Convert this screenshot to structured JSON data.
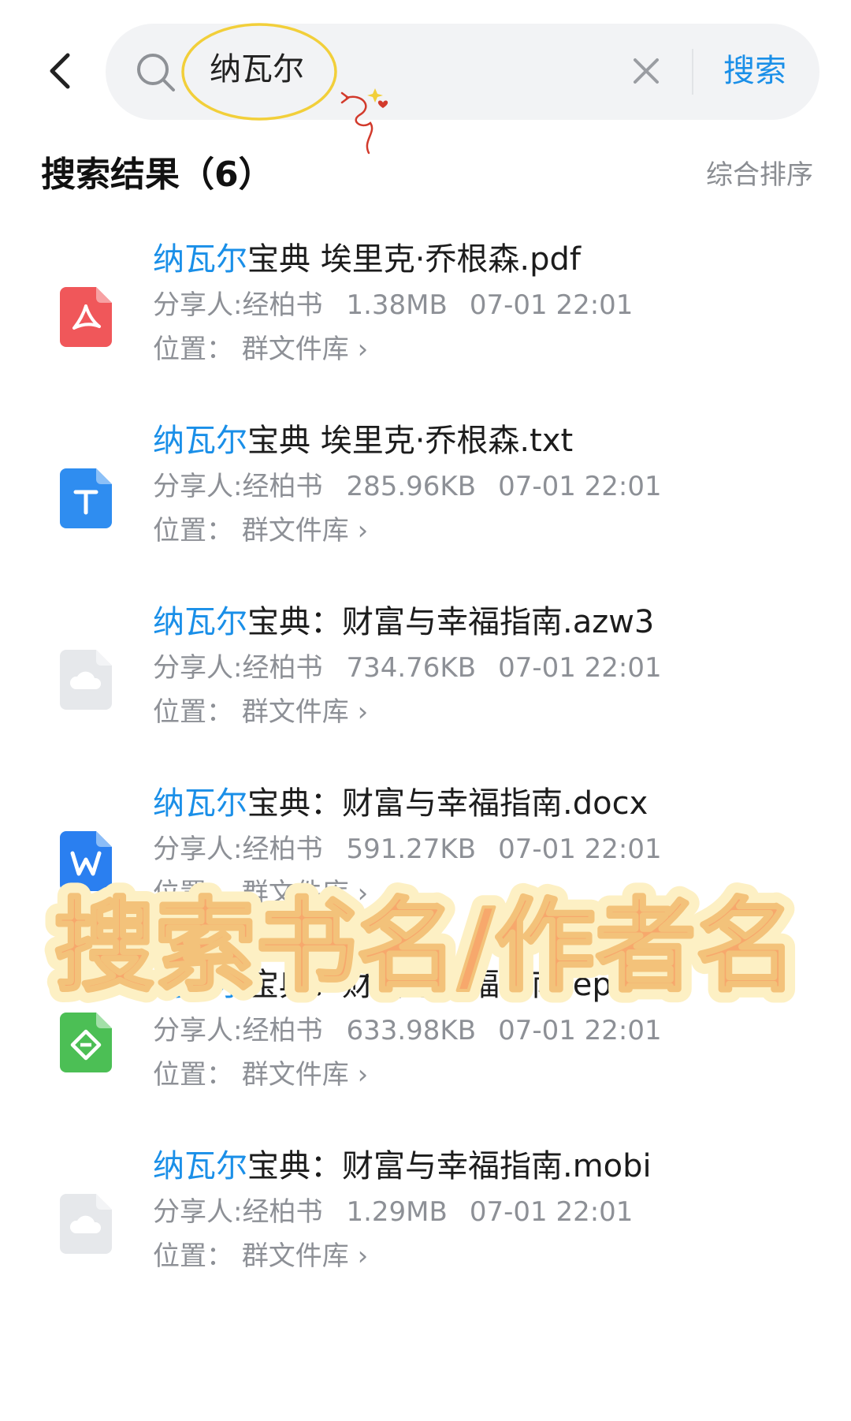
{
  "search": {
    "query": "纳瓦尔",
    "submit_label": "搜索"
  },
  "results_header": {
    "title": "搜索结果（6）",
    "sort_label": "综合排序"
  },
  "results": [
    {
      "name_highlight": "纳瓦尔",
      "name_rest": "宝典 埃里克·乔根森.pdf",
      "sharer": "分享人:经柏书",
      "size": "1.38MB",
      "time": "07-01 22:01",
      "location": "位置：  群文件库",
      "icon": "pdf-file-icon"
    },
    {
      "name_highlight": "纳瓦尔",
      "name_rest": "宝典 埃里克·乔根森.txt",
      "sharer": "分享人:经柏书",
      "size": "285.96KB",
      "time": "07-01 22:01",
      "location": "位置：  群文件库",
      "icon": "txt-file-icon"
    },
    {
      "name_highlight": "纳瓦尔",
      "name_rest": "宝典：财富与幸福指南.azw3",
      "sharer": "分享人:经柏书",
      "size": "734.76KB",
      "time": "07-01 22:01",
      "location": "位置：  群文件库",
      "icon": "cloud-file-icon"
    },
    {
      "name_highlight": "纳瓦尔",
      "name_rest": "宝典：财富与幸福指南.docx",
      "sharer": "分享人:经柏书",
      "size": "591.27KB",
      "time": "07-01 22:01",
      "location": "位置：  群文件库",
      "icon": "word-file-icon"
    },
    {
      "name_highlight": "纳瓦尔",
      "name_rest": "宝典：财富与幸福指南.epub",
      "sharer": "分享人:经柏书",
      "size": "633.98KB",
      "time": "07-01 22:01",
      "location": "位置：  群文件库",
      "icon": "epub-file-icon"
    },
    {
      "name_highlight": "纳瓦尔",
      "name_rest": "宝典：财富与幸福指南.mobi",
      "sharer": "分享人:经柏书",
      "size": "1.29MB",
      "time": "07-01 22:01",
      "location": "位置：  群文件库",
      "icon": "cloud-file-icon"
    }
  ],
  "overlay": {
    "caption": "搜索书名/作者名",
    "fill_color": "#f7a86c",
    "outline_color": "#fdf0c4",
    "shadow_color": "#f3c27a"
  },
  "colors": {
    "accent": "#1a8fe8",
    "pdf": "#f0575a",
    "txt": "#2f8df0",
    "word": "#2a7ff0",
    "epub": "#4cbf55",
    "cloud": "#e6e8eb"
  }
}
